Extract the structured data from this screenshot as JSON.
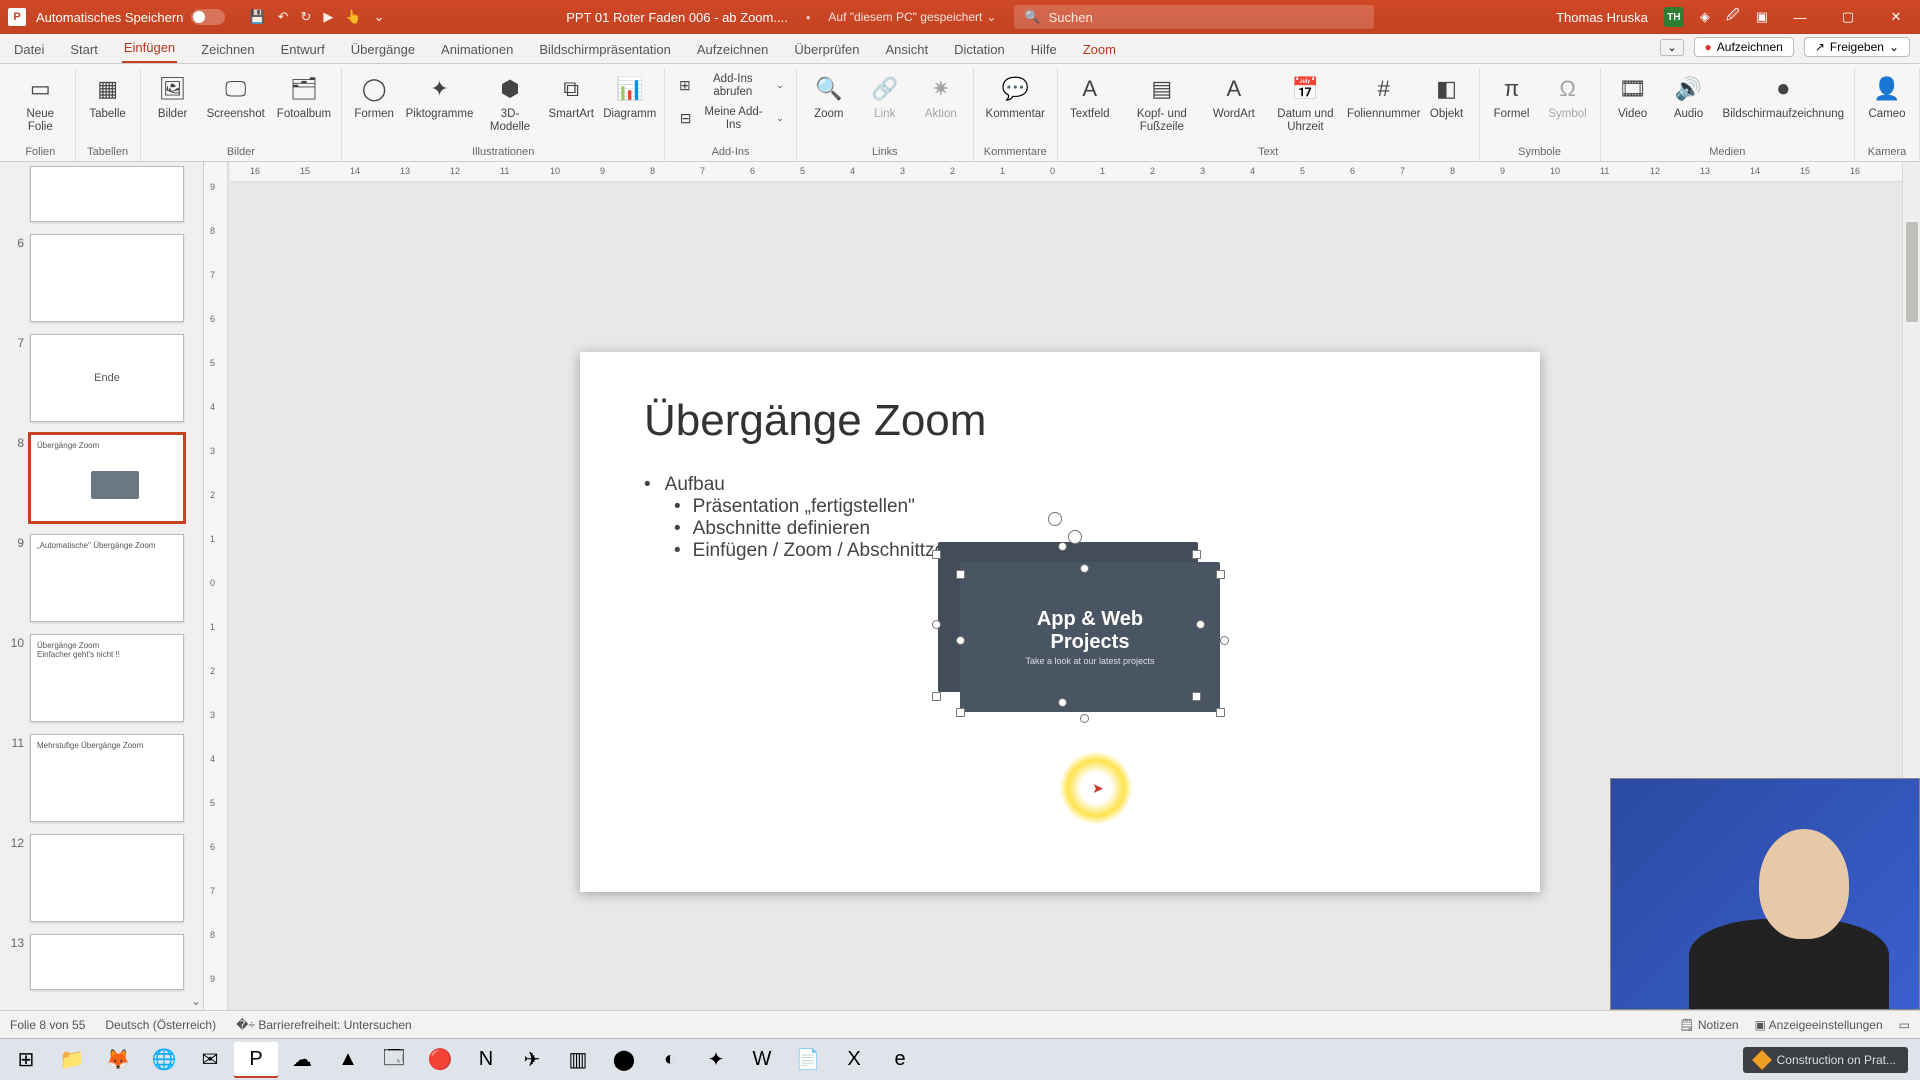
{
  "titlebar": {
    "autosave_label": "Automatisches Speichern",
    "doc_name": "PPT 01 Roter Faden 006 - ab Zoom....",
    "saved_location": "Auf \"diesem PC\" gespeichert",
    "search_placeholder": "Suchen",
    "user_name": "Thomas Hruska",
    "user_initials": "TH"
  },
  "tabs": {
    "items": [
      "Datei",
      "Start",
      "Einfügen",
      "Zeichnen",
      "Entwurf",
      "Übergänge",
      "Animationen",
      "Bildschirmpräsentation",
      "Aufzeichnen",
      "Überprüfen",
      "Ansicht",
      "Dictation",
      "Hilfe",
      "Zoom"
    ],
    "active_index": 2,
    "record_btn": "Aufzeichnen",
    "share_btn": "Freigeben"
  },
  "ribbon": {
    "groups": [
      {
        "label": "Folien",
        "items": [
          {
            "t": "Neue Folie",
            "ico": "▭"
          }
        ]
      },
      {
        "label": "Tabellen",
        "items": [
          {
            "t": "Tabelle",
            "ico": "▦"
          }
        ]
      },
      {
        "label": "Bilder",
        "items": [
          {
            "t": "Bilder",
            "ico": "🖼"
          },
          {
            "t": "Screenshot",
            "ico": "🖵"
          },
          {
            "t": "Fotoalbum",
            "ico": "🗂"
          }
        ]
      },
      {
        "label": "Illustrationen",
        "items": [
          {
            "t": "Formen",
            "ico": "◯"
          },
          {
            "t": "Piktogramme",
            "ico": "✦"
          },
          {
            "t": "3D-Modelle",
            "ico": "⬢"
          },
          {
            "t": "SmartArt",
            "ico": "⧉"
          },
          {
            "t": "Diagramm",
            "ico": "📊"
          }
        ]
      },
      {
        "label": "Add-Ins",
        "items": [
          {
            "t": "Add-Ins abrufen",
            "ico": "⊞",
            "small": true
          },
          {
            "t": "Meine Add-Ins",
            "ico": "⊟",
            "small": true
          }
        ]
      },
      {
        "label": "Links",
        "items": [
          {
            "t": "Zoom",
            "ico": "🔍"
          },
          {
            "t": "Link",
            "ico": "🔗",
            "disabled": true
          },
          {
            "t": "Aktion",
            "ico": "✷",
            "disabled": true
          }
        ]
      },
      {
        "label": "Kommentare",
        "items": [
          {
            "t": "Kommentar",
            "ico": "💬"
          }
        ]
      },
      {
        "label": "Text",
        "items": [
          {
            "t": "Textfeld",
            "ico": "A"
          },
          {
            "t": "Kopf- und Fußzeile",
            "ico": "▤"
          },
          {
            "t": "WordArt",
            "ico": "A"
          },
          {
            "t": "Datum und Uhrzeit",
            "ico": "📅"
          },
          {
            "t": "Foliennummer",
            "ico": "#"
          },
          {
            "t": "Objekt",
            "ico": "◧"
          }
        ]
      },
      {
        "label": "Symbole",
        "items": [
          {
            "t": "Formel",
            "ico": "π"
          },
          {
            "t": "Symbol",
            "ico": "Ω",
            "disabled": true
          }
        ]
      },
      {
        "label": "Medien",
        "items": [
          {
            "t": "Video",
            "ico": "🎞"
          },
          {
            "t": "Audio",
            "ico": "🔊"
          },
          {
            "t": "Bildschirmaufzeichnung",
            "ico": "⏺"
          }
        ]
      },
      {
        "label": "Kamera",
        "items": [
          {
            "t": "Cameo",
            "ico": "👤"
          }
        ]
      }
    ]
  },
  "ruler": {
    "h_ticks": [
      "16",
      "15",
      "14",
      "13",
      "12",
      "11",
      "10",
      "9",
      "8",
      "7",
      "6",
      "5",
      "4",
      "3",
      "2",
      "1",
      "0",
      "1",
      "2",
      "3",
      "4",
      "5",
      "6",
      "7",
      "8",
      "9",
      "10",
      "11",
      "12",
      "13",
      "14",
      "15",
      "16"
    ],
    "v_ticks": [
      "9",
      "8",
      "7",
      "6",
      "5",
      "4",
      "3",
      "2",
      "1",
      "0",
      "1",
      "2",
      "3",
      "4",
      "5",
      "6",
      "7",
      "8",
      "9"
    ]
  },
  "thumbs": [
    {
      "num": "",
      "title": "",
      "partial": true
    },
    {
      "num": "6",
      "title": ""
    },
    {
      "num": "7",
      "title": "Ende"
    },
    {
      "num": "8",
      "title": "Übergänge Zoom",
      "selected": true
    },
    {
      "num": "9",
      "title": "„Automatische\" Übergänge Zoom"
    },
    {
      "num": "10",
      "title": "Übergänge Zoom\nEinfacher geht's nicht !!"
    },
    {
      "num": "11",
      "title": "Mehrstufige Übergänge Zoom"
    },
    {
      "num": "12",
      "title": ""
    },
    {
      "num": "13",
      "title": "",
      "partial": true
    }
  ],
  "slide": {
    "title": "Übergänge Zoom",
    "bullets": {
      "l1": "Aufbau",
      "l2a": "Präsentation „fertigstellen\"",
      "l2b": "Abschnitte definieren",
      "l2c": "Einfügen / Zoom / Abschnittzoom"
    },
    "zoom_objects": [
      {
        "t1": "App & Web",
        "t2": "Projects",
        "sub": "Take a look at our latest projects"
      },
      {
        "t1": "App & Web",
        "t2": "Projects",
        "sub": "Take a look at our latest projects"
      }
    ]
  },
  "status": {
    "slide_info": "Folie 8 von 55",
    "language": "Deutsch (Österreich)",
    "accessibility": "Barrierefreiheit: Untersuchen",
    "notes": "Notizen",
    "display_settings": "Anzeigeeinstellungen"
  },
  "taskbar": {
    "toast": "Construction on Prat..."
  }
}
